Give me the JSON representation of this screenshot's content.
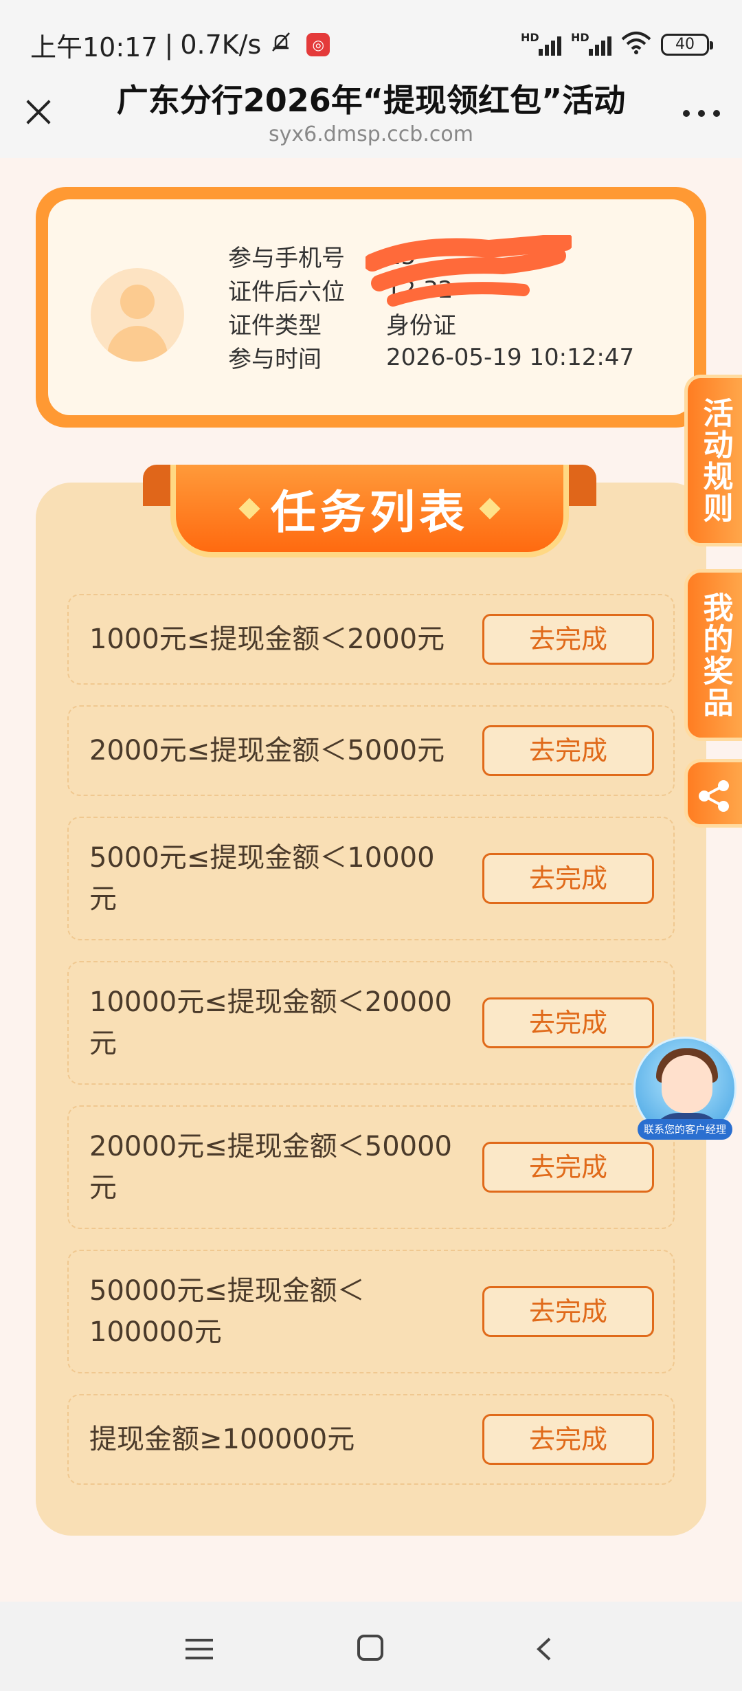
{
  "status_bar": {
    "time": "上午10:17",
    "speed": "0.7K/s",
    "battery": "40",
    "signal_label": "HD"
  },
  "nav": {
    "title": "广东分行2026年“提现领红包”活动",
    "url": "syx6.dmsp.ccb.com"
  },
  "user_info": {
    "rows": [
      {
        "label": "参与手机号",
        "value": "15"
      },
      {
        "label": "证件后六位",
        "value": "12  32"
      },
      {
        "label": "证件类型",
        "value": "身份证"
      },
      {
        "label": "参与时间",
        "value": "2026-05-19 10:12:47"
      }
    ]
  },
  "task_list": {
    "title": "任务列表",
    "button_label": "去完成",
    "items": [
      {
        "text": "1000元≤提现金额＜2000元"
      },
      {
        "text": "2000元≤提现金额＜5000元"
      },
      {
        "text": "5000元≤提现金额＜10000元"
      },
      {
        "text": "10000元≤提现金额＜20000元"
      },
      {
        "text": "20000元≤提现金额＜50000元"
      },
      {
        "text": "50000元≤提现金额＜100000元"
      },
      {
        "text": "提现金额≥100000元"
      }
    ]
  },
  "side_tabs": {
    "rules": "活动规则",
    "prizes": "我的奖品"
  },
  "customer_service": {
    "label": "联系您的客户经理"
  },
  "colors": {
    "accent": "#ff7d22",
    "panel": "#f9dfb5",
    "button_text": "#e06a1a"
  }
}
